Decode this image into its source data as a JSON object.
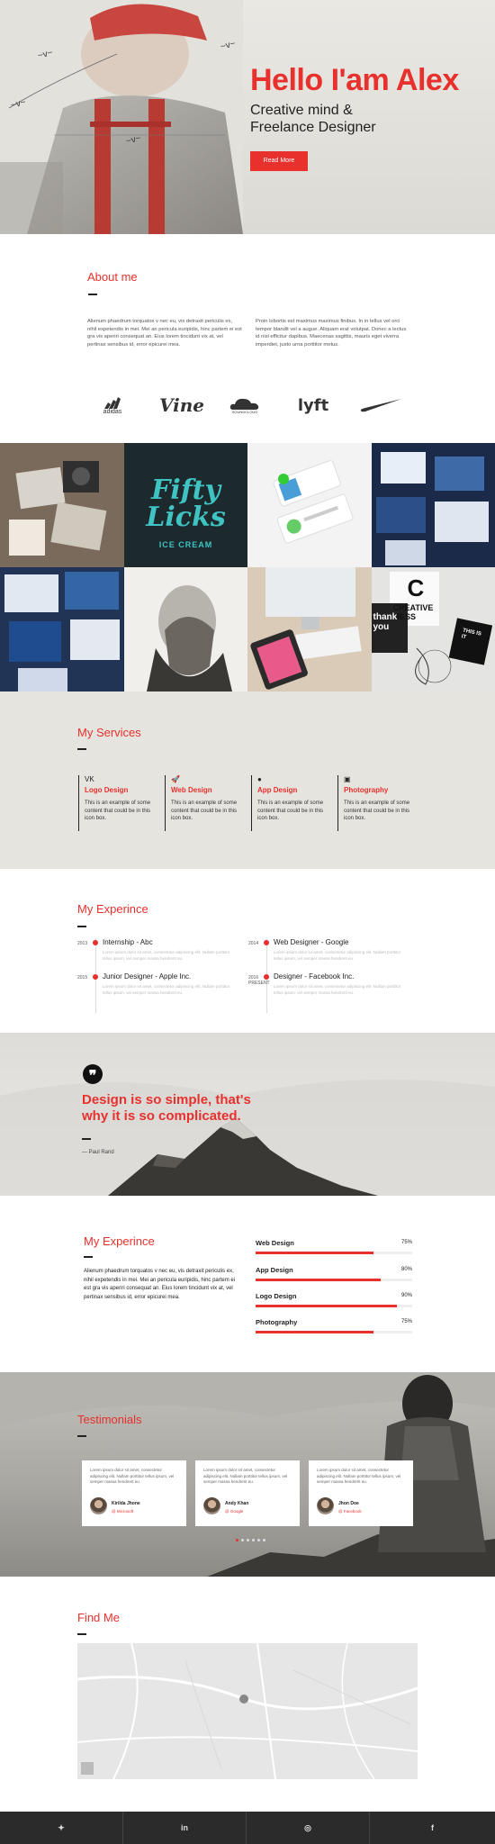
{
  "hero": {
    "title": "Hello I'am Alex",
    "subtitle_line1": "Creative mind &",
    "subtitle_line2": "Freelance Designer",
    "cta": "Read More"
  },
  "about": {
    "heading": "About me",
    "col1": "Alienum phaedrum torquatos v nec eu, vis detraxit periculis ex, nihil expetendis in mei. Mei an pericula euripidis, hinc partem ei est gra vis aperiri consequat an. Eius lorem tincidunt vix at, vel pertinax sensibus id, error epicurei mea.",
    "col2": "Proin lobortis est maximus maximus finibus. In in tellus vel orci tempor blandit vel a augue. Aliquam erat volutpat. Donec a lectus id nisl efficitur dapibus. Maecenas sagittis, mauris eget viverra imperdiet, justo urna porttitor metus.",
    "logos": [
      "adidas",
      "Vine",
      "SOUNDCLOUD",
      "lyft",
      "nike"
    ]
  },
  "gallery": {
    "tiles": [
      "cameras",
      "fifty-licks-ice-cream",
      "app-cards",
      "screens",
      "screens-2",
      "double-exposure-portrait",
      "imac-desk",
      "creative-mess"
    ],
    "fifty_text": "Fifty Licks",
    "ice_cream_text": "ICE CREAM",
    "creative_text": "CREATIVE MESS",
    "c_letter": "C",
    "thank_text": "thank you",
    "this_is_text": "THIS IS IT"
  },
  "services": {
    "heading": "My Services",
    "items": [
      {
        "icon": "vk-icon",
        "glyph": "VK",
        "title": "Logo Design",
        "desc": "This is an example of some content that could be in this icon box."
      },
      {
        "icon": "rocket-icon",
        "glyph": "🚀",
        "title": "Web Design",
        "desc": "This is an example of some content that could be in this icon box."
      },
      {
        "icon": "apple-icon",
        "glyph": "",
        "title": "App Design",
        "desc": "This is an example of some content that could be in this icon box."
      },
      {
        "icon": "instagram-icon",
        "glyph": "▣",
        "title": "Photography",
        "desc": "This is an example of some content that could be in this icon box."
      }
    ]
  },
  "experience": {
    "heading": "My Experince",
    "jobs": [
      {
        "year": "2013",
        "title": "Internship - Abc",
        "desc": "Lorem ipsum dolor sit amet, consectetur adipiscing elit. Nullam porttitor tellus ipsum, vel semper massa hendrerit eu."
      },
      {
        "year": "2014",
        "title": "Web Designer - Google",
        "desc": "Lorem ipsum dolor sit amet, consectetur adipiscing elit. Nullam porttitor tellus ipsum, vel semper massa hendrerit eu."
      },
      {
        "year": "2015",
        "title": "Junior Designer - Apple Inc.",
        "desc": "Lorem ipsum dolor sit amet, consectetur adipiscing elit. Nullam porttitor tellus ipsum, vel semper massa hendrerit eu."
      },
      {
        "year": "2016",
        "year2": "PRESENT",
        "title": "Designer - Facebook Inc.",
        "desc": "Lorem ipsum dolor sit amet, consectetur adipiscing elit. Nullam porttitor tellus ipsum, vel semper massa hendrerit eu."
      }
    ]
  },
  "quote": {
    "icon_glyph": "❞",
    "text": "Design is so simple, that's why it is so complicated.",
    "author": "— Paul Rand"
  },
  "skills": {
    "heading": "My Experince",
    "paragraph": "Alienum phaedrum torquatos v nec eu, vis detraxit periculis ex, nihil expetendis in mei. Mei an pericula euripidis, hinc partem ei est gra vis aperiri consequat an. Eius lorem tincidunt vix at, vel pertinax sensibus id, error epicurei mea.",
    "items": [
      {
        "name": "Web Design",
        "label": "75%",
        "value": 75
      },
      {
        "name": "App Design",
        "label": "80%",
        "value": 80
      },
      {
        "name": "Logo Design",
        "label": "90%",
        "value": 90
      },
      {
        "name": "Photography",
        "label": "75%",
        "value": 75
      }
    ]
  },
  "testimonials": {
    "heading": "Testimonials",
    "cards": [
      {
        "text": "Lorem ipsum dolor sit amet, consectetur adipiscing elit. Nullam porttitor tellus ipsum, vel semper massa hendrerit eu.",
        "name": "Kirilda Jhone",
        "company": "@ Microsoft"
      },
      {
        "text": "Lorem ipsum dolor sit amet, consectetur adipiscing elit. Nullam porttitor tellus ipsum, vel semper massa hendrerit eu.",
        "name": "Andy Khan",
        "company": "@ Google"
      },
      {
        "text": "Lorem ipsum dolor sit amet, consectetur adipiscing elit. Nullam porttitor tellus ipsum, vel semper massa hendrerit eu.",
        "name": "Jhon Doe",
        "company": "@ Facebook"
      }
    ],
    "active_dot": 0,
    "dot_count": 6
  },
  "find": {
    "heading": "Find Me"
  },
  "footer": {
    "links": [
      {
        "icon": "twitter-icon",
        "glyph": "🐦"
      },
      {
        "icon": "linkedin-icon",
        "glyph": "in"
      },
      {
        "icon": "instagram-icon",
        "glyph": "◎"
      },
      {
        "icon": "facebook-icon",
        "glyph": "f"
      }
    ]
  },
  "colors": {
    "accent": "#e8302d",
    "dark": "#2b2b2b",
    "services_bg": "#e6e4df"
  }
}
